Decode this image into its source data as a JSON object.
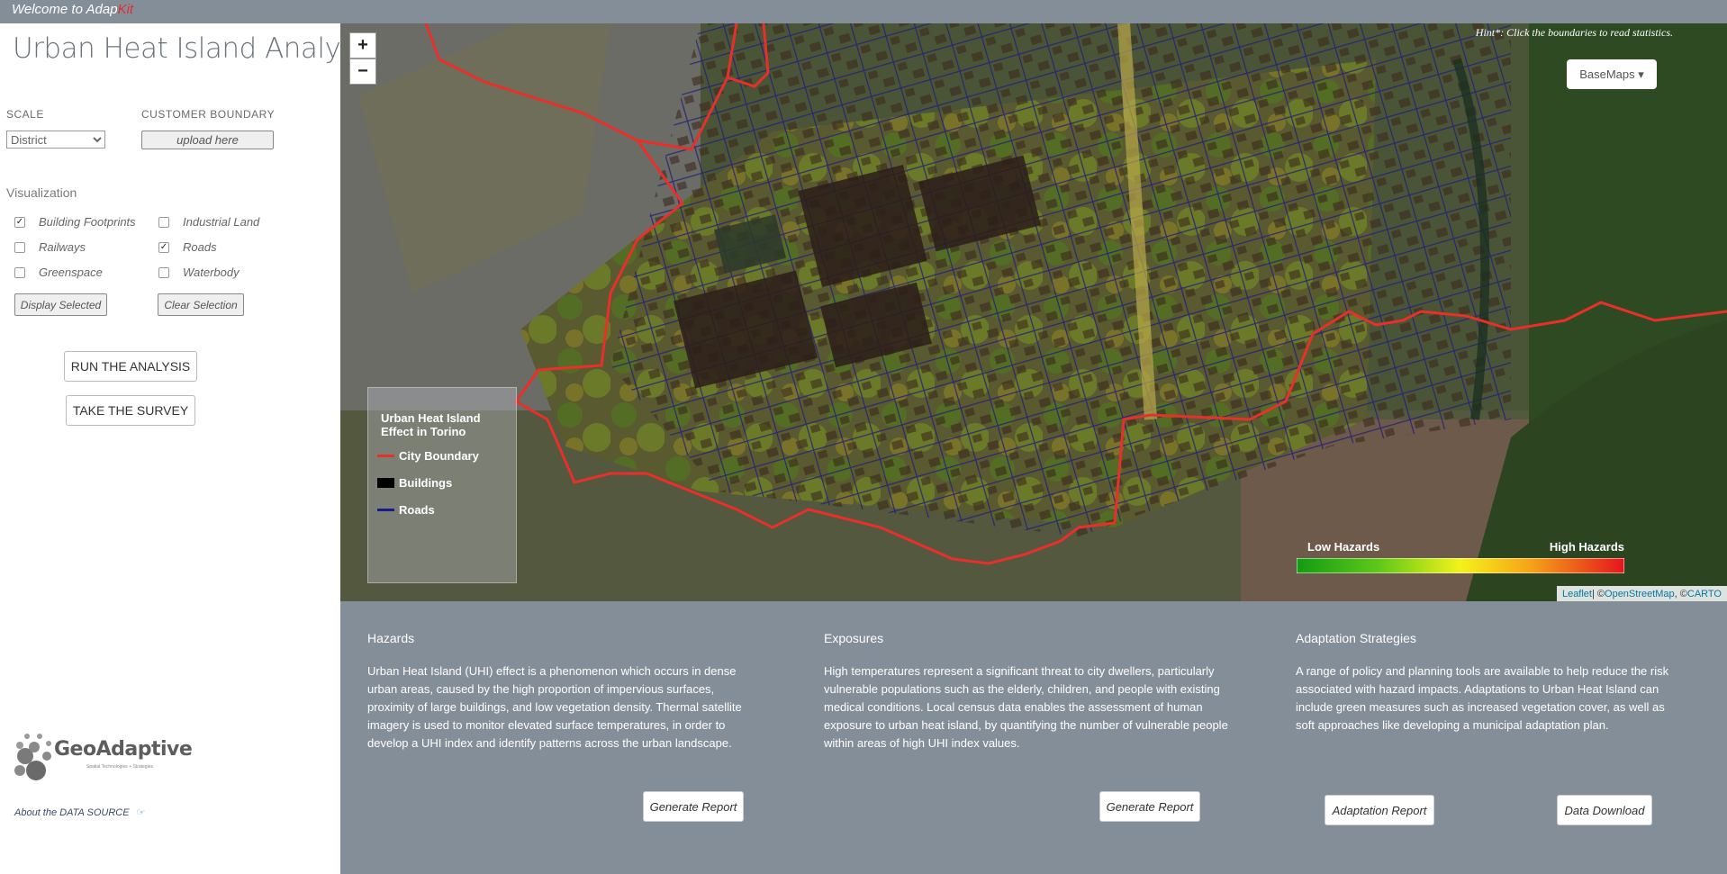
{
  "topbar": {
    "welcome": "Welcome to Adap",
    "brand_accent": "Kit"
  },
  "sidebar": {
    "title": "Urban Heat Island Analyst",
    "scale_label": "SCALE",
    "scale_value": "District",
    "boundary_label": "CUSTOMER BOUNDARY",
    "upload_label": "upload here",
    "visualization_title": "Visualization",
    "layers": [
      {
        "label": "Building Footprints",
        "checked": true
      },
      {
        "label": "Industrial Land",
        "checked": false
      },
      {
        "label": "Railways",
        "checked": false
      },
      {
        "label": "Roads",
        "checked": true
      },
      {
        "label": "Greenspace",
        "checked": false
      },
      {
        "label": "Waterbody",
        "checked": false
      }
    ],
    "display_selected": "Display Selected",
    "clear_selection": "Clear Selection",
    "run_analysis": "RUN THE ANALYSIS",
    "take_survey": "TAKE THE SURVEY",
    "logo": {
      "name": "GeoAdaptive",
      "tagline": "Spatial Technologies + Strategies"
    },
    "about": "About the DATA SOURCE"
  },
  "map": {
    "zoom_in": "+",
    "zoom_out": "−",
    "hint": "Hint*: Click the boundaries to read statistics.",
    "basemaps": "BaseMaps ▾",
    "legend": {
      "title": "Urban Heat Island Effect in Torino",
      "items": [
        {
          "label": "City Boundary",
          "color": "#e8302a"
        },
        {
          "label": "Buildings",
          "color": "#000000"
        },
        {
          "label": "Roads",
          "color": "#1b1a8c"
        }
      ]
    },
    "hazard_scale": {
      "low": "Low Hazards",
      "high": "High Hazards"
    },
    "attribution": {
      "leaflet": "Leaflet",
      "sep1": " | © ",
      "osm": "OpenStreetMap",
      "sep2": ", © ",
      "carto": "CARTO"
    }
  },
  "panels": [
    {
      "title": "Hazards",
      "text": "Urban Heat Island (UHI) effect is a phenomenon which occurs in dense urban areas, caused by the high proportion of impervious surfaces, proximity of large buildings, and low vegetation density. Thermal satellite imagery is used to monitor elevated surface temperatures, in order to develop a UHI index and identify patterns across the urban landscape.",
      "button": "Generate Report"
    },
    {
      "title": "Exposures",
      "text": "High temperatures represent a significant threat to city dwellers, particularly vulnerable populations such as the elderly, children, and people with existing medical conditions. Local census data enables the assessment of human exposure to urban heat island, by quantifying the number of vulnerable people within areas of high UHI index values.",
      "button": "Generate Report"
    },
    {
      "title": "Adaptation Strategies",
      "text": "A range of policy and planning tools are available to help reduce the risk associated with hazard impacts. Adaptations to Urban Heat Island can include green measures such as increased vegetation cover, as well as soft approaches like developing a municipal adaptation plan.",
      "buttons": [
        "Adaptation Report",
        "Data Download"
      ]
    }
  ]
}
